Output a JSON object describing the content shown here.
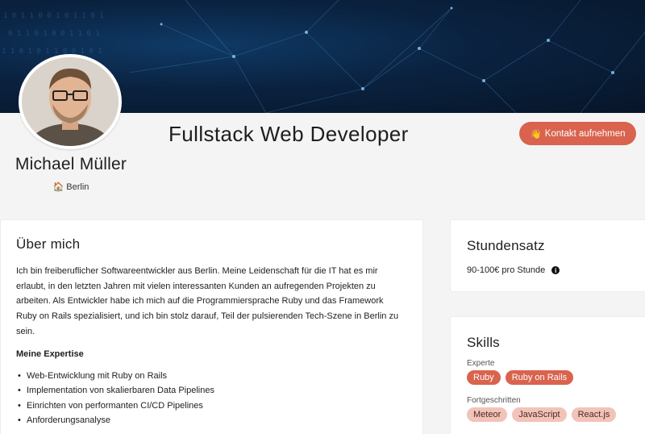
{
  "profile": {
    "name": "Michael Müller",
    "location": "Berlin",
    "job_title": "Fullstack Web Developer",
    "contact_icon": "👋",
    "contact_label": "Kontakt aufnehmen"
  },
  "about": {
    "heading": "Über mich",
    "text": "Ich bin freiberuflicher Softwareentwickler aus Berlin. Meine Leidenschaft für die IT hat es mir erlaubt, in den letzten Jahren mit vielen interessanten Kunden an aufregenden Projekten zu arbeiten. Als Entwickler habe ich mich auf die Programmiersprache Ruby und das Framework Ruby on Rails spezialisiert, und ich bin stolz darauf, Teil der pulsierenden Tech-Szene in Berlin zu sein.",
    "expertise_heading": "Meine Expertise",
    "expertise": [
      "Web-Entwicklung mit Ruby on Rails",
      "Implementation von skalierbaren Data Pipelines",
      "Einrichten von performanten CI/CD Pipelines",
      "Anforderungsanalyse"
    ]
  },
  "rate": {
    "heading": "Stundensatz",
    "value": "90-100€ pro Stunde"
  },
  "skills": {
    "heading": "Skills",
    "levels": [
      {
        "label": "Experte",
        "tags": [
          "Ruby",
          "Ruby on Rails"
        ]
      },
      {
        "label": "Fortgeschritten",
        "tags": [
          "Meteor",
          "JavaScript",
          "React.js"
        ]
      }
    ]
  },
  "colors": {
    "accent": "#d9634e",
    "tag_light": "#f2c3b9",
    "banner": "#0a2240"
  },
  "icons": {
    "location": "home-icon",
    "rate_info": "info-icon",
    "contact": "waving-hand-icon"
  }
}
